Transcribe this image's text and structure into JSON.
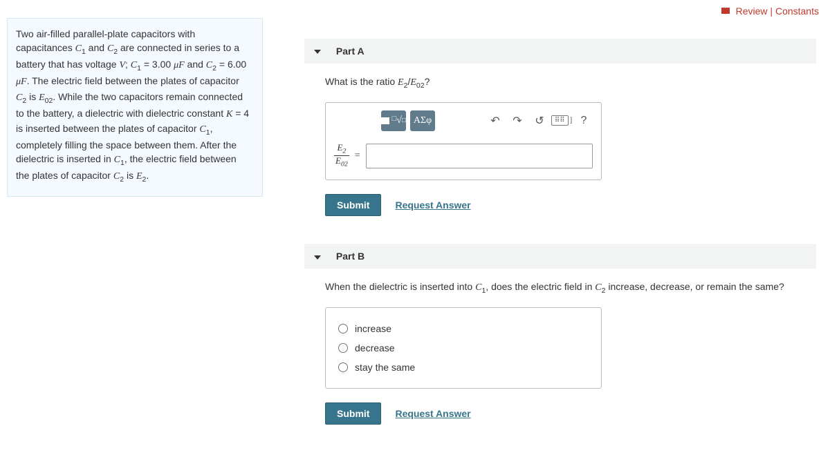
{
  "topLinks": {
    "review": "Review",
    "constants": "Constants"
  },
  "problem": {
    "p1": "Two air-filled parallel-plate capacitors with capacitances ",
    "c1": "C",
    "c1sub": "1",
    "p2": " and ",
    "c2": "C",
    "c2sub": "2",
    "p3": " are connected in series to a battery that has voltage ",
    "V": "V",
    "p4": "; ",
    "c1eq": "C",
    "c1eqsub": "1",
    "c1val": " = 3.00 ",
    "c1unit": "μF",
    "p5": " and ",
    "c2eq": "C",
    "c2eqsub": "2",
    "c2val": " = 6.00 ",
    "c2unit": "μF",
    "p6": ". The electric field between the plates of capacitor ",
    "c2b": "C",
    "c2bsub": "2",
    "p7": " is ",
    "E02": "E",
    "E02sub": "02",
    "p8": ". While the two capacitors remain connected to the battery, a dielectric with dielectric constant ",
    "K": "K",
    "Kval": " = 4",
    "p9": " is inserted between the plates of capacitor ",
    "c1c": "C",
    "c1csub": "1",
    "p10": ", completely filling the space between them. After the dielectric is inserted in ",
    "c1d": "C",
    "c1dsub": "1",
    "p11": ", the electric field between the plates of capacitor ",
    "c2c": "C",
    "c2csub": "2",
    "p12": " is ",
    "E2": "E",
    "E2sub": "2",
    "p13": "."
  },
  "partA": {
    "title": "Part A",
    "prompt_pre": "What is the ratio ",
    "ratio_num": "E",
    "ratio_num_sub": "2",
    "ratio_slash": "/",
    "ratio_den": "E",
    "ratio_den_sub": "02",
    "prompt_post": "?",
    "toolbar": {
      "templates": "√",
      "greek": "ΑΣφ",
      "undo": "↶",
      "redo": "↷",
      "reset": "↺",
      "keyboard": "⌨",
      "help": "?"
    },
    "frac_num": "E",
    "frac_num_sub": "2",
    "frac_den": "E",
    "frac_den_sub": "02",
    "equals": "=",
    "submit": "Submit",
    "request": "Request Answer"
  },
  "partB": {
    "title": "Part B",
    "prompt_pre": "When the dielectric is inserted into ",
    "c1": "C",
    "c1sub": "1",
    "prompt_mid": ", does the electric field in ",
    "c2": "C",
    "c2sub": "2",
    "prompt_post": " increase, decrease, or remain the same?",
    "options": {
      "a": "increase",
      "b": "decrease",
      "c": "stay the same"
    },
    "submit": "Submit",
    "request": "Request Answer"
  }
}
